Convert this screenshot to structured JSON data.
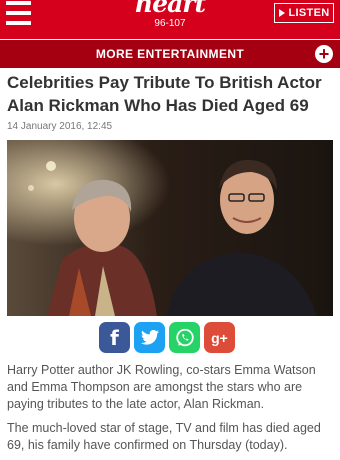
{
  "header": {
    "logo_word": "heart",
    "logo_frequency": "96-107",
    "listen_label": "LISTEN"
  },
  "subnav": {
    "label": "MORE ENTERTAINMENT"
  },
  "article": {
    "headline": "Celebrities Pay Tribute To British Actor Alan Rickman Who Has Died Aged 69",
    "date": "14 January 2016, 12:45",
    "paragraphs": [
      "Harry Potter author JK Rowling, co-stars Emma Watson and Emma Thompson are amongst the stars who are paying tributes to the late actor, Alan Rickman.",
      "The much-loved star of stage, TV and film has died aged 69, his family have confirmed on Thursday (today)."
    ]
  },
  "share": {
    "facebook_glyph": "f",
    "googleplus_glyph": "g+"
  },
  "colors": {
    "brand_red": "#d5001c",
    "subnav_red": "#a50012",
    "facebook": "#3b5998",
    "twitter": "#1da1f2",
    "whatsapp": "#25d366",
    "googleplus": "#dd4b39"
  },
  "icons": [
    "hamburger-menu-icon",
    "play-icon",
    "plus-icon",
    "facebook-icon",
    "twitter-icon",
    "whatsapp-icon",
    "googleplus-icon"
  ]
}
